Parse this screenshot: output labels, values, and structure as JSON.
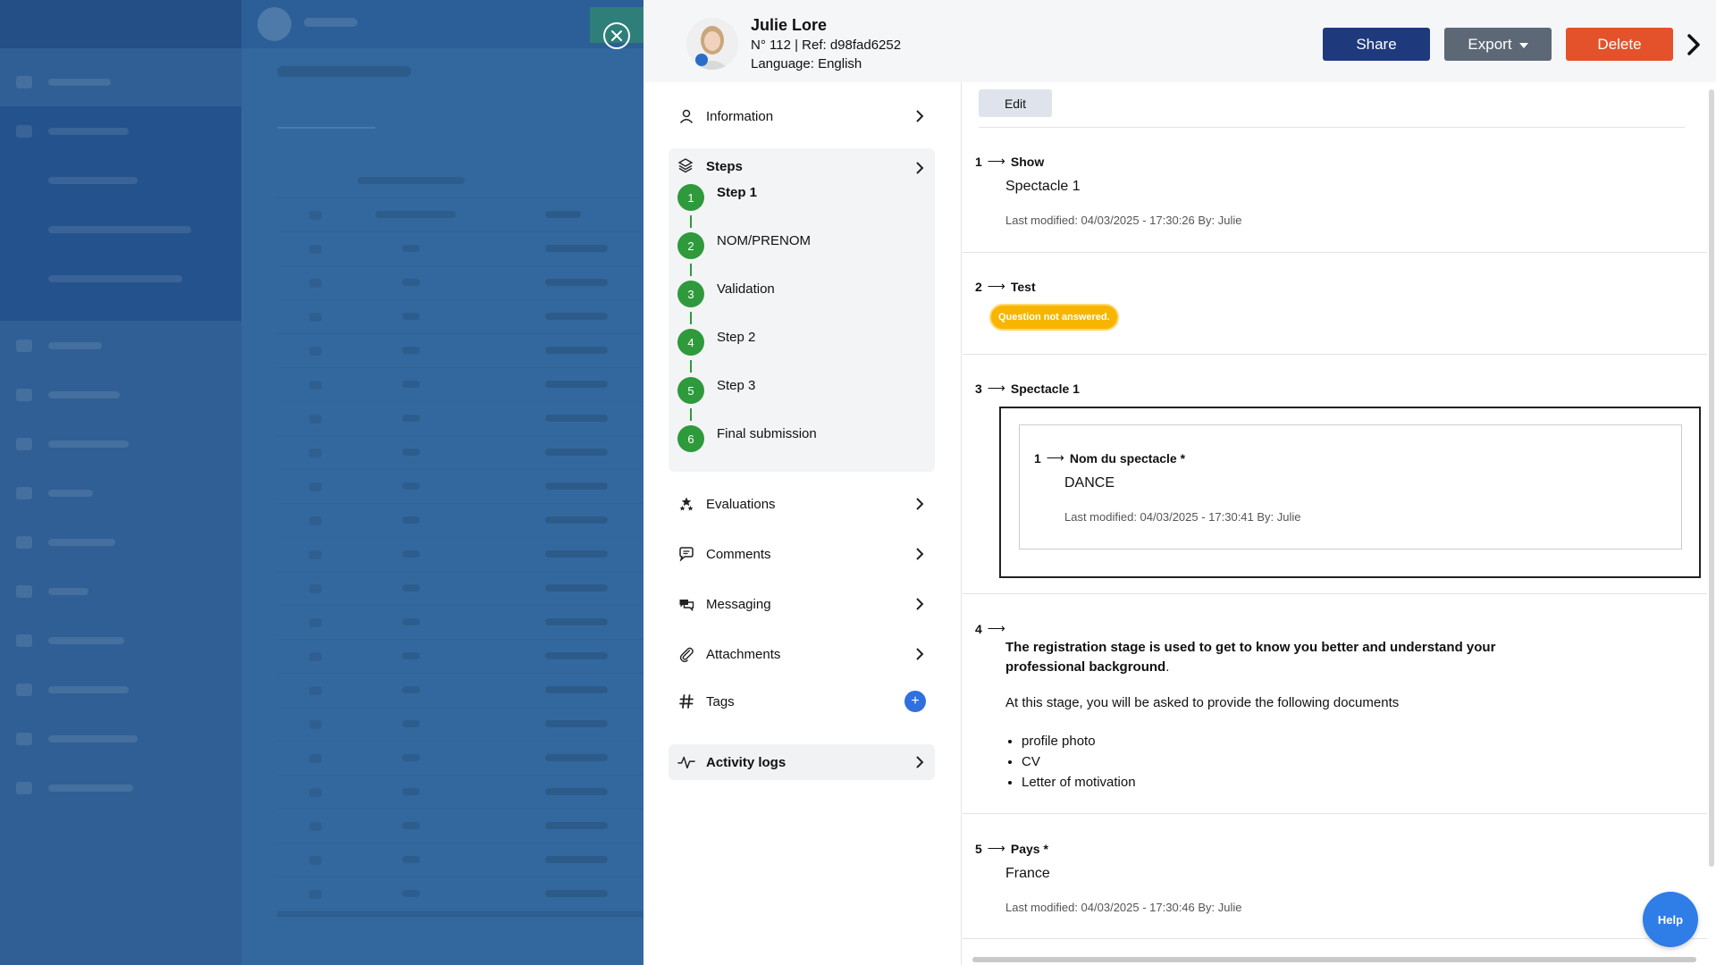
{
  "header": {
    "name": "Julie Lore",
    "ref": "N° 112 | Ref: d98fad6252",
    "language": "Language: English",
    "share_label": "Share",
    "export_label": "Export",
    "delete_label": "Delete"
  },
  "menu": {
    "information": "Information",
    "steps": "Steps",
    "step_items": [
      {
        "num": "1",
        "label": "Step 1"
      },
      {
        "num": "2",
        "label": "NOM/PRENOM"
      },
      {
        "num": "3",
        "label": "Validation"
      },
      {
        "num": "4",
        "label": "Step 2"
      },
      {
        "num": "5",
        "label": "Step 3"
      },
      {
        "num": "6",
        "label": "Final submission"
      }
    ],
    "evaluations": "Evaluations",
    "comments": "Comments",
    "messaging": "Messaging",
    "attachments": "Attachments",
    "tags": "Tags",
    "add_tag": "+",
    "activity_logs": "Activity logs"
  },
  "content": {
    "edit_label": "Edit",
    "arrow": "⟶",
    "q1": {
      "num": "1",
      "title": "Show",
      "answer": "Spectacle 1",
      "modified": "Last modified: 04/03/2025 - 17:30:26 By: Julie"
    },
    "q2": {
      "num": "2",
      "title": "Test",
      "badge": "Question not answered."
    },
    "q3": {
      "num": "3",
      "title": "Spectacle 1",
      "sub": {
        "num": "1",
        "title": "Nom du spectacle *",
        "answer": "DANCE",
        "modified": "Last modified: 04/03/2025 - 17:30:41 By: Julie"
      }
    },
    "q4": {
      "num": "4",
      "bold_text": "The registration stage is used to get to know you better and understand your professional background",
      "dot": ".",
      "paragraph": "At this stage, you will be asked to provide the following documents",
      "list": [
        "profile photo",
        "CV",
        "Letter of motivation"
      ]
    },
    "q5": {
      "num": "5",
      "title": "Pays *",
      "answer": "France",
      "modified": "Last modified: 04/03/2025 - 17:30:46 By: Julie"
    }
  },
  "help_label": "Help",
  "colors": {
    "share": "#1f3a7c",
    "export": "#5d6877",
    "delete": "#e3522a",
    "step": "#2e9a3b",
    "badge": "#f7b500",
    "help": "#2f7de6"
  }
}
